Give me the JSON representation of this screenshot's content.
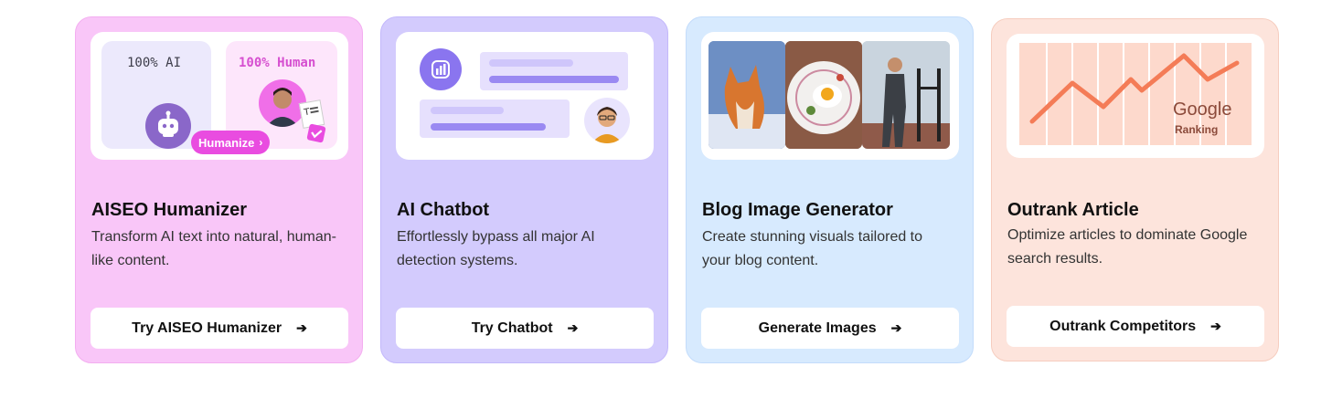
{
  "cards": [
    {
      "title": "AISEO Humanizer",
      "description": "Transform AI text into natural, human-like content.",
      "button": "Try AISEO Humanizer",
      "illustration": {
        "left_label": "100% AI",
        "right_label": "100% Human",
        "pill": "Humanize"
      },
      "color": "#f9c6f8"
    },
    {
      "title": "AI Chatbot",
      "description": "Effortlessly bypass all major AI detection systems.",
      "button": "Try Chatbot",
      "color": "#d3cbfd"
    },
    {
      "title": "Blog Image Generator",
      "description": "Create stunning visuals tailored to your blog content.",
      "button": "Generate Images",
      "color": "#d7eafe"
    },
    {
      "title": "Outrank Article",
      "description": "Optimize articles to dominate Google search results.",
      "button": "Outrank Competitors",
      "illustration": {
        "brand": "Google",
        "caption": "Ranking"
      },
      "color": "#fde4dc"
    }
  ],
  "icons": {
    "button_arrow": "arrow-right-icon",
    "robot": "robot-icon",
    "chat_logo": "chat-logo-icon",
    "chart_line": "trend-line-icon"
  },
  "accent": "#e94ce0"
}
